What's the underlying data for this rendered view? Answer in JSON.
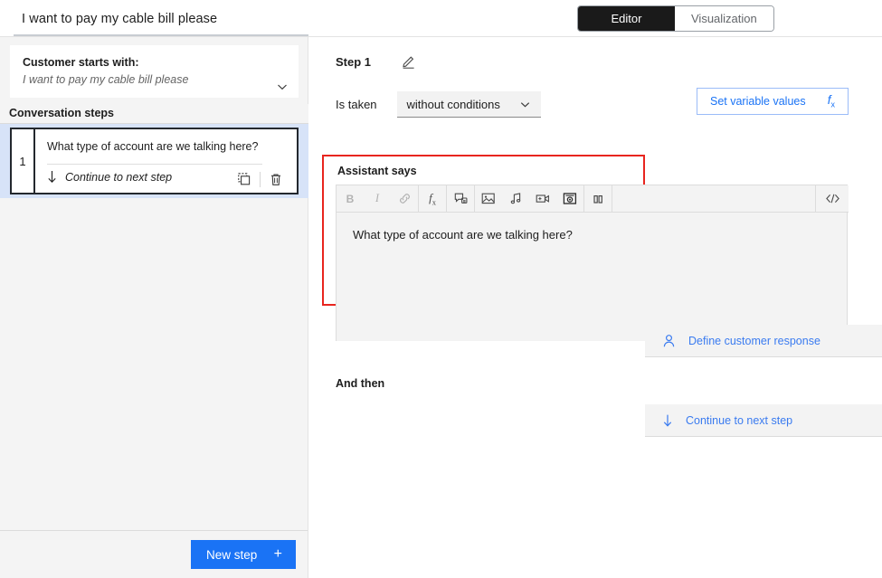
{
  "topbar": {
    "flow_title": "I want to pay my cable bill please",
    "tabs": [
      {
        "label": "Editor",
        "active": true
      },
      {
        "label": "Visualization",
        "active": false
      }
    ]
  },
  "sidebar": {
    "starts_with": {
      "label": "Customer starts with:",
      "value": "I want to pay my cable bill please",
      "chevron_icon": "chevron-down-icon"
    },
    "steps_header": "Conversation steps",
    "steps": [
      {
        "number": "1",
        "text": "What type of account are we talking here?",
        "action_icon": "arrow-down-icon",
        "action_text": "Continue to next step",
        "duplicate_icon": "duplicate-icon",
        "delete_icon": "trash-icon"
      }
    ],
    "new_step_button": {
      "label": "New step",
      "plus": "+"
    }
  },
  "main": {
    "step_title": "Step 1",
    "edit_icon": "pencil-icon",
    "is_taken_label": "Is taken",
    "condition_value": "without conditions",
    "condition_chevron": "chevron-down-icon",
    "set_variable_button": {
      "label": "Set variable values",
      "icon": "fx-icon"
    },
    "assistant_says_label": "Assistant says",
    "toolbar": [
      {
        "name": "bold-icon",
        "glyph": "B",
        "dim": true
      },
      {
        "name": "italic-icon",
        "glyph": "I",
        "dim": true
      },
      {
        "name": "link-icon",
        "glyph": "link",
        "dim": true
      },
      {
        "name": "fx-icon",
        "glyph": "fx",
        "dim": false
      },
      {
        "name": "chat-bubble-icon",
        "glyph": "bubble",
        "dim": false
      },
      {
        "name": "image-icon",
        "glyph": "image",
        "dim": false
      },
      {
        "name": "audio-icon",
        "glyph": "music",
        "dim": false
      },
      {
        "name": "video-icon",
        "glyph": "video",
        "dim": false
      },
      {
        "name": "record-icon",
        "glyph": "record",
        "dim": false
      },
      {
        "name": "carousel-icon",
        "glyph": "carousel",
        "dim": false
      }
    ],
    "code_view_icon": "code-icon",
    "assistant_text": "What type of account are we talking here?",
    "define_customer_response": {
      "icon": "person-icon",
      "label": "Define customer response",
      "chevron": "chevron-down-icon"
    },
    "and_then_label": "And then",
    "continue_row": {
      "icon": "arrow-down-icon",
      "label": "Continue to next step",
      "chevron": "chevron-down-icon"
    }
  },
  "colors": {
    "accent_blue": "#1a73f5",
    "link_blue": "#3a7bf0",
    "highlight_red": "#e8251f",
    "selection_blue": "#d7e3f8",
    "panel_grey": "#f3f3f3"
  }
}
